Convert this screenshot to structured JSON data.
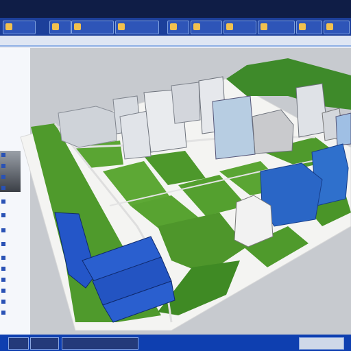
{
  "titlebar": {
    "bg": "#0f1d46"
  },
  "ribbon": {
    "icons": [
      "layers-icon",
      "building-icon",
      "tree-icon",
      "road-icon",
      "camera-icon",
      "measure-icon",
      "light-icon",
      "render-icon",
      "settings-icon",
      "export-icon",
      "grid-icon",
      "terrain-icon",
      "water-icon",
      "sun-icon",
      "zoom-icon",
      "pan-icon"
    ]
  },
  "sidebar": {
    "rows": [
      "",
      "",
      "",
      "",
      "",
      "",
      "",
      "",
      "",
      "",
      "",
      "",
      "",
      ""
    ]
  },
  "scene": {
    "accent_blue": "#2456c8",
    "grass": "#4f9a2c",
    "ground": "#f0f0ef"
  },
  "bottombar": {
    "bg": "#0e3fb0"
  }
}
